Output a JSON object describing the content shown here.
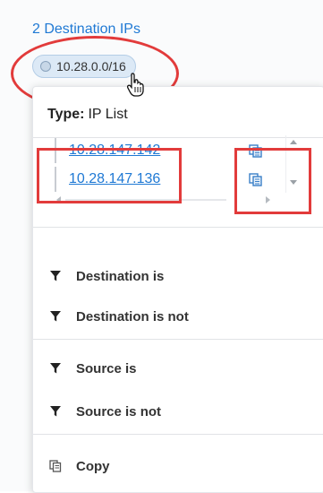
{
  "background": {
    "header": "2 Destination IPs",
    "chip_label": "10.28.0.0/16"
  },
  "popup": {
    "type_label": "Type:",
    "type_value": "IP List",
    "ips": [
      "10.28.147.142",
      "10.28.147.136"
    ],
    "menu_group_1": [
      {
        "label": "Destination is",
        "icon": "filter-icon"
      },
      {
        "label": "Destination is not",
        "icon": "filter-icon"
      }
    ],
    "menu_group_2": [
      {
        "label": "Source is",
        "icon": "filter-icon"
      },
      {
        "label": "Source is not",
        "icon": "filter-icon"
      }
    ],
    "copy_label": "Copy",
    "copy_icon": "copy-icon"
  },
  "colors": {
    "link": "#1f79d4",
    "annotation_red": "#e23b3b",
    "chip_bg": "#dce9f6"
  }
}
